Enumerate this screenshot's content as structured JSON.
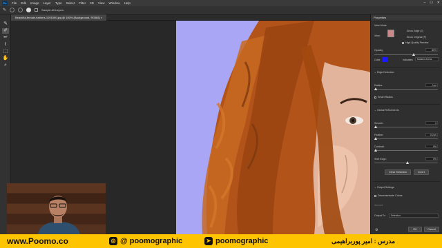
{
  "menubar": {
    "app_badge": "Ps",
    "items": [
      "File",
      "Edit",
      "Image",
      "Layer",
      "Type",
      "Select",
      "Filter",
      "3D",
      "View",
      "Window",
      "Help"
    ]
  },
  "options_bar": {
    "checkbox_label": "Sample All Layers"
  },
  "document": {
    "tab_title": "Beautiful-female-bathers-1091590.jpg @ 100% (Background, RGB/8)"
  },
  "properties": {
    "title": "Properties",
    "view_mode_label": "View Mode",
    "view_label": "View:",
    "show_edge": "Show Edge (J)",
    "show_original": "Show Original (P)",
    "hq_preview": "High Quality Preview",
    "opacity_label": "Opacity",
    "opacity_value": "80%",
    "color_label": "Color",
    "indicates_label": "Indicates:",
    "indicates_value": "Masked Areas",
    "edge_detection": "Edge Detection",
    "radius_label": "Radius:",
    "radius_value": "0 px",
    "smart_radius": "Smart Radius",
    "global_refinements": "Global Refinements",
    "smooth_label": "Smooth:",
    "smooth_value": "0",
    "feather_label": "Feather:",
    "feather_value": "0.0 px",
    "contrast_label": "Contrast:",
    "contrast_value": "0%",
    "shift_edge_label": "Shift Edge:",
    "shift_edge_value": "0%",
    "clear_selection": "Clear Selection",
    "invert": "Invert",
    "output_settings": "Output Settings",
    "decontaminate": "Decontaminate Colors",
    "amount_label": "Amount:",
    "output_to_label": "Output To:",
    "output_to_value": "Selection",
    "ok": "OK",
    "cancel": "Cancel",
    "overlay_color": "#1a1aff"
  },
  "footer": {
    "website": "www.Poomo.co",
    "instagram": "@ poomographic",
    "telegram": "poomographic",
    "instructor": "مدرس : امیر پوربراهیمی"
  }
}
